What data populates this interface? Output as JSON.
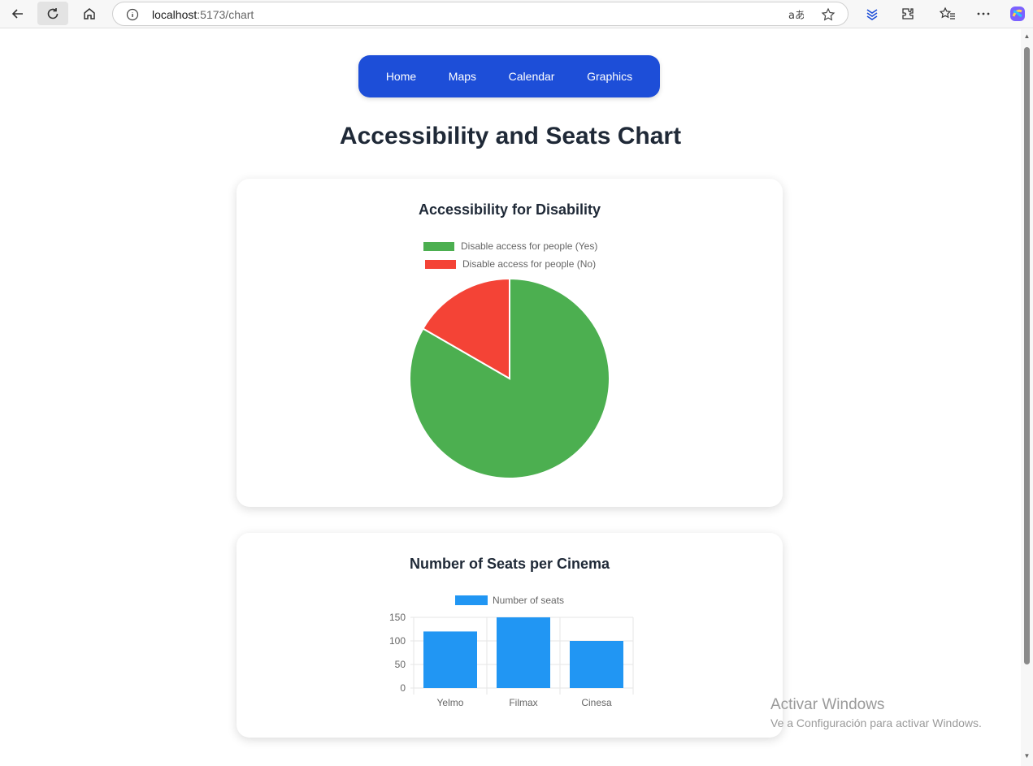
{
  "browser": {
    "url_host": "localhost",
    "url_path": ":5173/chart"
  },
  "nav": {
    "items": [
      "Home",
      "Maps",
      "Calendar",
      "Graphics"
    ]
  },
  "page": {
    "title": "Accessibility and Seats Chart"
  },
  "colors": {
    "nav_bg": "#1d4ed8",
    "yes": "#4caf50",
    "no": "#f44336",
    "bar": "#2196f3"
  },
  "charts": {
    "pie": {
      "title": "Accessibility for Disability"
    },
    "bar": {
      "title": "Number of Seats per Cinema"
    }
  },
  "chart_data": [
    {
      "type": "pie",
      "title": "Accessibility for Disability",
      "labels": [
        "Disable access for people (Yes)",
        "Disable access for people (No)"
      ],
      "values": [
        5,
        1
      ],
      "colors": [
        "#4caf50",
        "#f44336"
      ],
      "legend": "top"
    },
    {
      "type": "bar",
      "title": "Number of Seats per Cinema",
      "categories": [
        "Yelmo",
        "Filmax",
        "Cinesa"
      ],
      "series": [
        {
          "name": "Number of seats",
          "values": [
            120,
            150,
            100
          ]
        }
      ],
      "ylim": [
        0,
        150
      ],
      "yticks": [
        0,
        50,
        100,
        150
      ],
      "grid": true,
      "legend": "top",
      "color": "#2196f3"
    }
  ],
  "watermark": {
    "title": "Activar Windows",
    "subtitle": "Ve a Configuración para activar Windows."
  }
}
